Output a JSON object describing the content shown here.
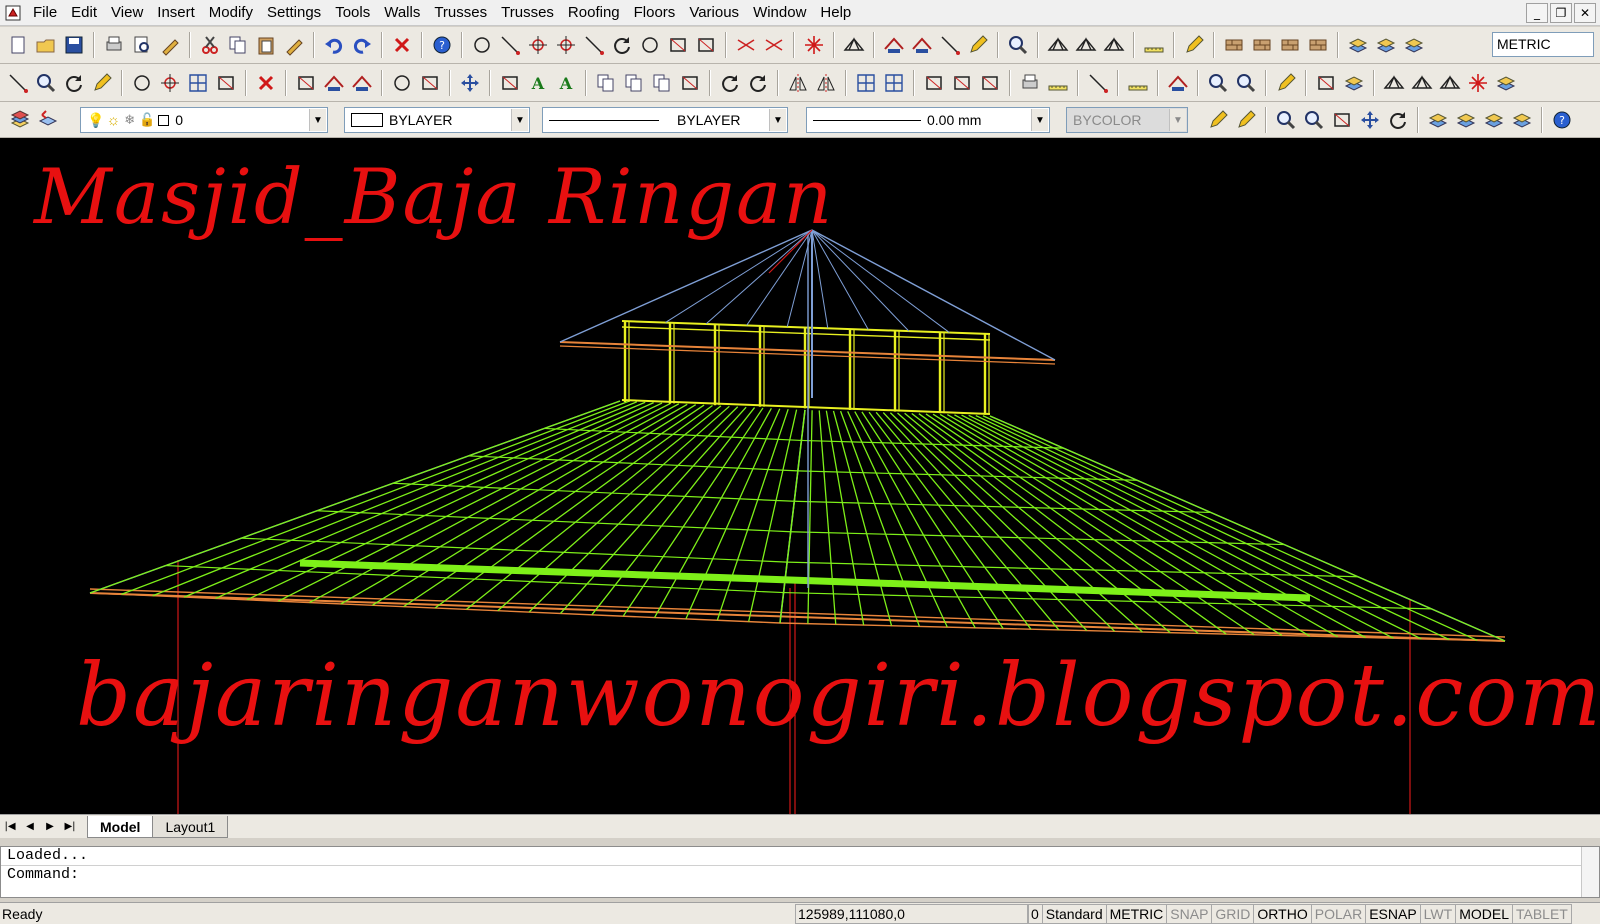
{
  "window": {
    "menu": [
      "File",
      "Edit",
      "View",
      "Insert",
      "Modify",
      "Settings",
      "Tools",
      "Walls",
      "Trusses",
      "Trusses",
      "Roofing",
      "Floors",
      "Various",
      "Window",
      "Help"
    ],
    "controls": {
      "minimize": "_",
      "restore": "❐",
      "close": "✕"
    }
  },
  "toolbar": {
    "units_value": "METRIC",
    "layer_value": "0",
    "color_value": "BYLAYER",
    "linetype_value": "BYLAYER",
    "lineweight_value": "0.00 mm",
    "plotstyle_value": "BYCOLOR"
  },
  "drawing": {
    "title_text": "Masjid_Baja Ringan",
    "url_text": "bajaringanwonogiri.blogspot.com",
    "colors": {
      "background": "#000000",
      "annotation": "#e81010",
      "truss_green": "#7ef019",
      "truss_yellow": "#e8f020",
      "edge_blue": "#7f9fd6",
      "fascia_orange": "#e8843a"
    }
  },
  "layout_tabs": {
    "nav": [
      "|◀",
      "◀",
      "▶",
      "▶|"
    ],
    "tabs": [
      "Model",
      "Layout1"
    ],
    "active": "Model"
  },
  "command": {
    "history": "Loaded...",
    "prompt": "Command:"
  },
  "status": {
    "ready": "Ready",
    "coords": "125989,111080,0",
    "items": [
      {
        "label": "0",
        "on": true
      },
      {
        "label": "Standard",
        "on": true
      },
      {
        "label": "METRIC",
        "on": true
      },
      {
        "label": "SNAP",
        "on": false
      },
      {
        "label": "GRID",
        "on": false
      },
      {
        "label": "ORTHO",
        "on": true
      },
      {
        "label": "POLAR",
        "on": false
      },
      {
        "label": "ESNAP",
        "on": true
      },
      {
        "label": "LWT",
        "on": false
      },
      {
        "label": "MODEL",
        "on": true
      },
      {
        "label": "TABLET",
        "on": false
      }
    ]
  }
}
